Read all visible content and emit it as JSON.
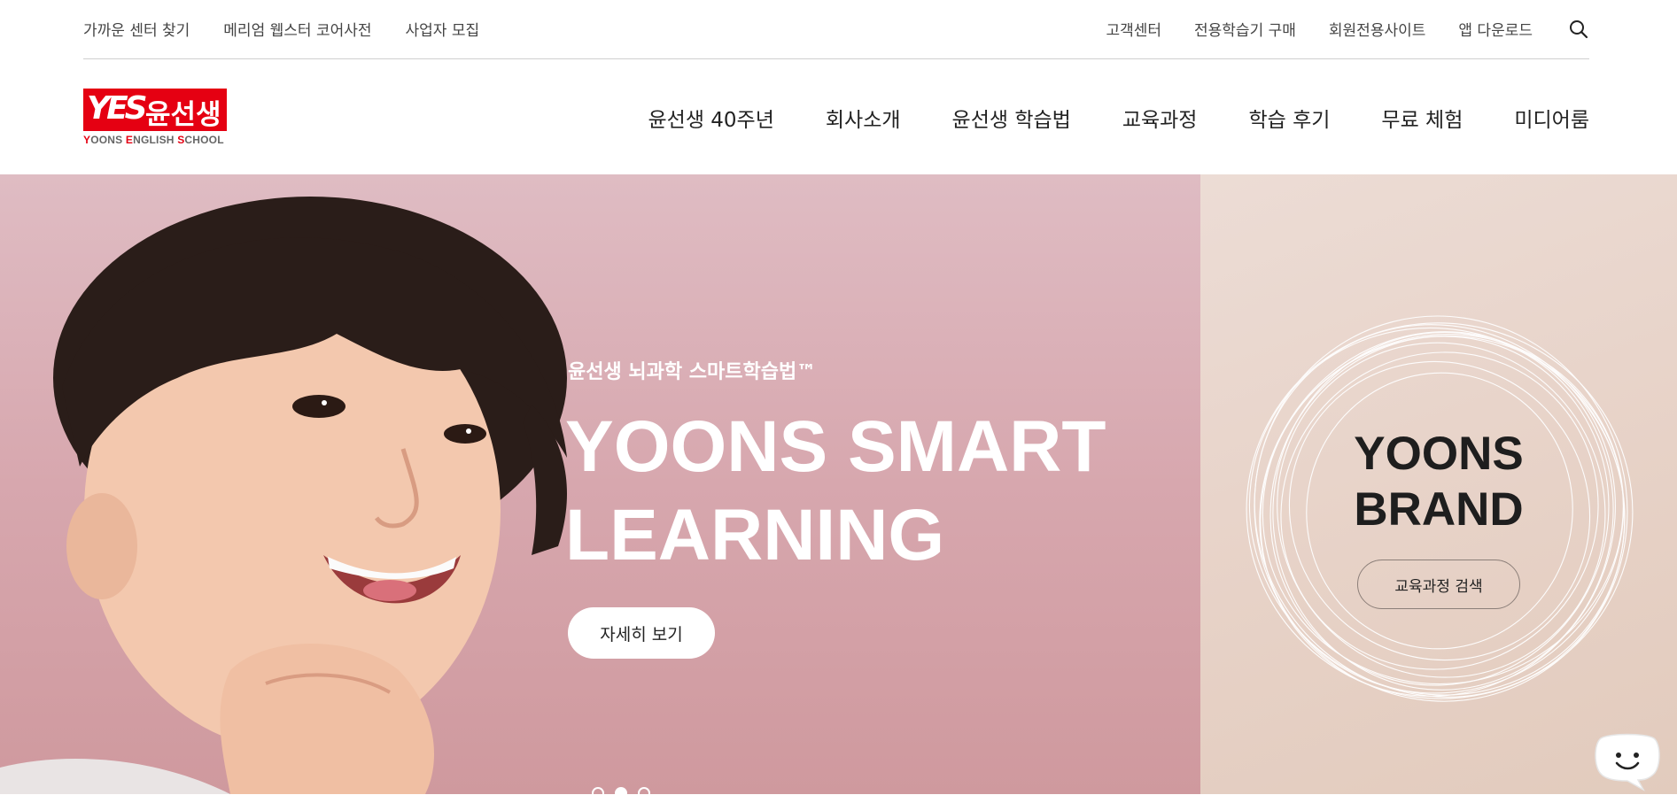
{
  "utility": {
    "left_links": [
      "가까운 센터 찾기",
      "메리엄 웹스터 코어사전",
      "사업자 모집"
    ],
    "right_links": [
      "고객센터",
      "전용학습기 구매",
      "회원전용사이트",
      "앱 다운로드"
    ]
  },
  "logo": {
    "mark": "YES",
    "korean": "윤선생",
    "english_parts": [
      "Y",
      "OONS ",
      "E",
      "NGLISH ",
      "S",
      "CHOOL"
    ]
  },
  "gnb": [
    "윤선생 40주년",
    "회사소개",
    "윤선생 학습법",
    "교육과정",
    "학습 후기",
    "무료 체험",
    "미디어룸"
  ],
  "hero": {
    "subtitle": "윤선생 뇌과학 스마트학습법™",
    "title_line1": "YOONS SMART",
    "title_line2": "LEARNING",
    "button": "자세히 보기",
    "pager_count": 3,
    "pager_active": 2
  },
  "brand": {
    "title_line1": "YOONS",
    "title_line2": "BRAND",
    "button": "교육과정 검색"
  },
  "colors": {
    "brand_red": "#e50012",
    "hero_bg": "#d8a9b0",
    "brand_panel_bg": "#e8d4ca"
  },
  "icons": [
    "search-icon",
    "chat-icon"
  ]
}
